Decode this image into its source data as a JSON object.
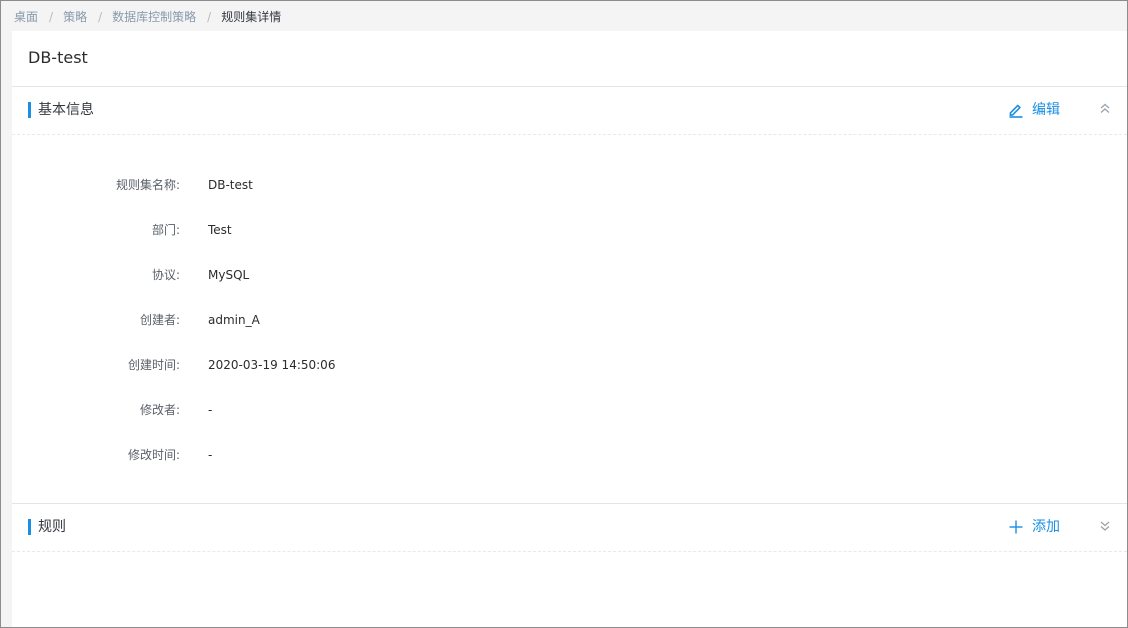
{
  "breadcrumb": {
    "items": [
      "桌面",
      "策略",
      "数据库控制策略"
    ],
    "separator": "/",
    "current": "规则集详情"
  },
  "page": {
    "title": "DB-test"
  },
  "basic_info": {
    "title": "基本信息",
    "edit_label": "编辑",
    "collapse_icon": "chevron-double-up-icon",
    "fields": [
      {
        "label": "规则集名称:",
        "value": "DB-test"
      },
      {
        "label": "部门:",
        "value": "Test"
      },
      {
        "label": "协议:",
        "value": "MySQL"
      },
      {
        "label": "创建者:",
        "value": "admin_A"
      },
      {
        "label": "创建时间:",
        "value": "2020-03-19 14:50:06"
      },
      {
        "label": "修改者:",
        "value": "-"
      },
      {
        "label": "修改时间:",
        "value": "-"
      }
    ]
  },
  "rules": {
    "title": "规则",
    "add_label": "添加",
    "collapse_icon": "chevron-double-down-icon"
  },
  "colors": {
    "accent": "#1a8fe3",
    "breadcrumb_link": "#8a9aac",
    "text": "#33383f"
  }
}
